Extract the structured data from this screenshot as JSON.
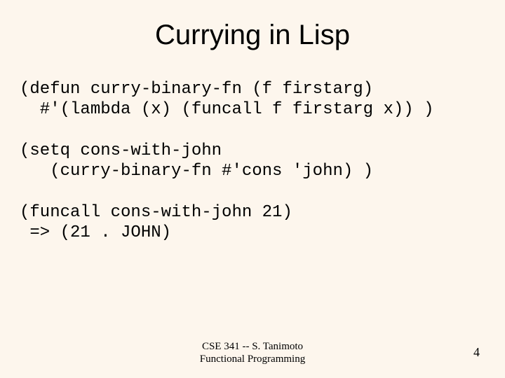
{
  "title": "Currying in Lisp",
  "code_block": "(defun curry-binary-fn (f firstarg)\n  #'(lambda (x) (funcall f firstarg x)) )\n\n(setq cons-with-john\n   (curry-binary-fn #'cons 'john) )\n\n(funcall cons-with-john 21)\n => (21 . JOHN)",
  "footer_line1": "CSE 341 -- S. Tanimoto",
  "footer_line2": "Functional Programming",
  "page_number": "4"
}
